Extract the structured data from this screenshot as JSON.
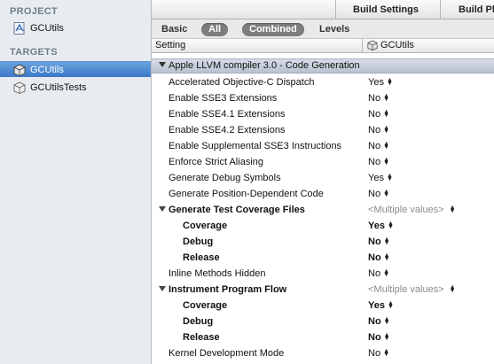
{
  "sidebar": {
    "project_header": "PROJECT",
    "project_item": "GCUtils",
    "targets_header": "TARGETS",
    "targets": [
      {
        "label": "GCUtils",
        "selected": true
      },
      {
        "label": "GCUtilsTests",
        "selected": false
      }
    ]
  },
  "top_tabs": {
    "build_settings": "Build Settings",
    "build_phases": "Build Ph"
  },
  "filter_bar": {
    "basic": "Basic",
    "all": "All",
    "combined": "Combined",
    "levels": "Levels"
  },
  "column_header": {
    "setting": "Setting",
    "target": "GCUtils"
  },
  "section": {
    "title": "Apple LLVM compiler 3.0 - Code Generation"
  },
  "rows": [
    {
      "name": "Accelerated Objective-C Dispatch",
      "value": "Yes"
    },
    {
      "name": "Enable SSE3 Extensions",
      "value": "No"
    },
    {
      "name": "Enable SSE4.1 Extensions",
      "value": "No"
    },
    {
      "name": "Enable SSE4.2 Extensions",
      "value": "No"
    },
    {
      "name": "Enable Supplemental SSE3 Instructions",
      "value": "No"
    },
    {
      "name": "Enforce Strict Aliasing",
      "value": "No"
    },
    {
      "name": "Generate Debug Symbols",
      "value": "Yes"
    },
    {
      "name": "Generate Position-Dependent Code",
      "value": "No"
    },
    {
      "name": "Generate Test Coverage Files",
      "value": "<Multiple values>"
    },
    {
      "name": "Coverage",
      "value": "Yes"
    },
    {
      "name": "Debug",
      "value": "No"
    },
    {
      "name": "Release",
      "value": "No"
    },
    {
      "name": "Inline Methods Hidden",
      "value": "No"
    },
    {
      "name": "Instrument Program Flow",
      "value": "<Multiple values>"
    },
    {
      "name": "Coverage",
      "value": "Yes"
    },
    {
      "name": "Debug",
      "value": "No"
    },
    {
      "name": "Release",
      "value": "No"
    },
    {
      "name": "Kernel Development Mode",
      "value": "No"
    }
  ],
  "colors": {
    "selection": "#3b78c8",
    "sidebar_bg": "#e8ecf1",
    "section_bg": "#c4ccd8",
    "pill": "#7d7d7d"
  }
}
